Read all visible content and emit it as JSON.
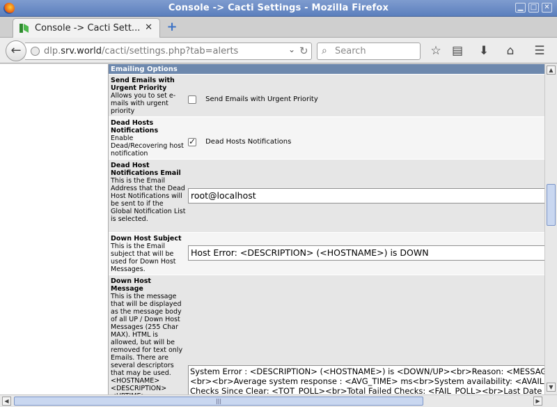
{
  "window": {
    "title": "Console -> Cacti Settings - Mozilla Firefox",
    "minimize": "▁",
    "maximize": "□",
    "close": "✕"
  },
  "tab": {
    "label": "Console -> Cacti Sett...",
    "close": "✕",
    "new_tab": "+"
  },
  "navbar": {
    "url_prefix": "dlp.",
    "url_domain": "srv.world",
    "url_path": "/cacti/settings.php?tab=alerts",
    "search_placeholder": "Search",
    "dropdown": "⌄",
    "reload": "↻"
  },
  "panel": {
    "header": "Emailing Options",
    "rows": [
      {
        "title": "Send Emails with Urgent Priority",
        "description": "Allows you to set e-mails with urgent priority",
        "checkbox_label": "Send Emails with Urgent Priority",
        "checked": false
      },
      {
        "title": "Dead Hosts Notifications",
        "description": "Enable Dead/Recovering host notification",
        "checkbox_label": "Dead Hosts Notifications",
        "checked": true
      },
      {
        "title": "Dead Host Notifications Email",
        "description": "This is the Email Address that the Dead Host Notifications will be sent to if the Global Notification List is selected.",
        "value": "root@localhost"
      },
      {
        "title": "Down Host Subject",
        "description": "This is the Email subject that will be used for Down Host Messages.",
        "value": "Host Error: <DESCRIPTION> (<HOSTNAME>) is DOWN"
      },
      {
        "title": "Down Host Message",
        "description": "This is the message that will be displayed as the message body of all UP / Down Host Messages (255 Char MAX). HTML is allowed, but will be removed for text only Emails. There are several descriptors that may be used. <HOSTNAME> <DESCRIPTION> <UPTIME>",
        "value": "System Error : <DESCRIPTION> (<HOSTNAME>) is <DOWN/UP><br>Reason: <MESSAGE>\n<br><br>Average system response : <AVG_TIME> ms<br>System availability: <AVAILABILITY>\nChecks Since Clear: <TOT_POLL><br>Total Failed Checks: <FAIL_POLL><br>Last Date Checked"
      }
    ]
  },
  "colors": {
    "panel_header": "#6d88ad",
    "titlebar": "#5b7fbd"
  },
  "icons": [
    "firefox-icon",
    "cacti-favicon",
    "back-arrow-icon",
    "globe-icon",
    "search-icon",
    "bookmark-star-icon",
    "reading-list-icon",
    "download-icon",
    "home-icon",
    "hamburger-menu-icon"
  ]
}
